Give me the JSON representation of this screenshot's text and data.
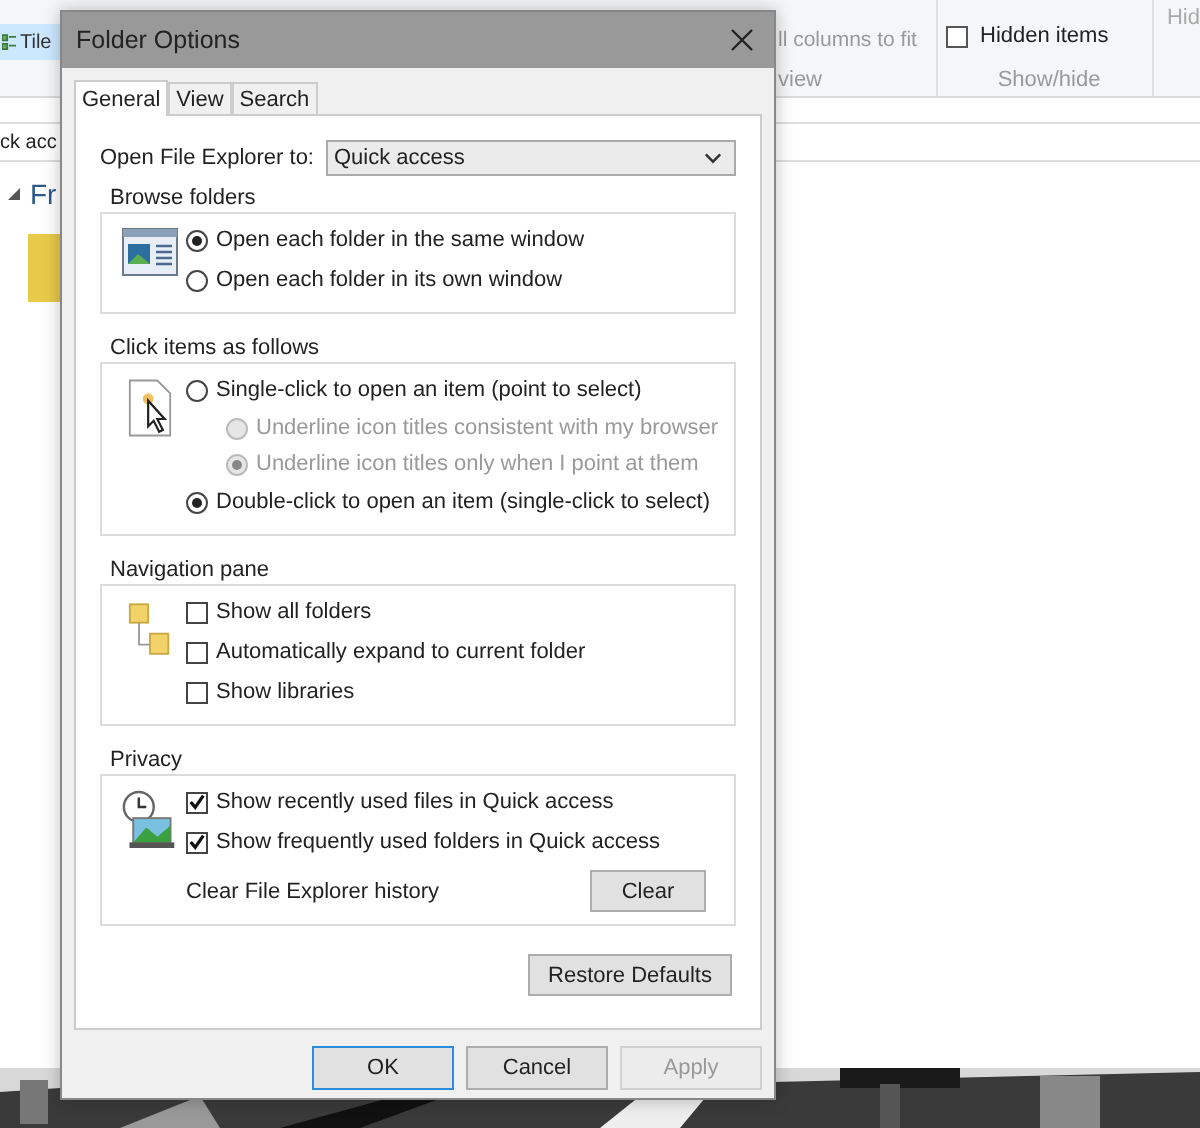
{
  "explorer": {
    "layout_items": [
      {
        "label": "Tile",
        "selected": true
      }
    ],
    "current_view": {
      "items": [
        "ll columns to fit"
      ],
      "group": "view"
    },
    "show_hide": {
      "items": [
        {
          "label": "Hidden items",
          "checked": false
        }
      ],
      "group": "Show/hide",
      "hide": "Hid"
    },
    "address": "ck acc",
    "nav_item": "Fr"
  },
  "dialog": {
    "title": "Folder Options",
    "tabs": [
      {
        "label": "General",
        "selected": true
      },
      {
        "label": "View",
        "selected": false
      },
      {
        "label": "Search",
        "selected": false
      }
    ],
    "open_to": {
      "label": "Open File Explorer to:",
      "value": "Quick access"
    },
    "groups": [
      {
        "kind": "radio",
        "title": "Browse folders",
        "options": [
          {
            "label": "Open each folder in the same window",
            "selected": true,
            "disabled": false
          },
          {
            "label": "Open each folder in its own window",
            "selected": false,
            "disabled": false
          }
        ]
      },
      {
        "kind": "radio",
        "title": "Click items as follows",
        "options": [
          {
            "label": "Single-click to open an item (point to select)",
            "selected": false,
            "disabled": false,
            "children": [
              {
                "label": "Underline icon titles consistent with my browser",
                "selected": false,
                "disabled": true
              },
              {
                "label": "Underline icon titles only when I point at them",
                "selected": true,
                "disabled": true
              }
            ]
          },
          {
            "label": "Double-click to open an item (single-click to select)",
            "selected": true,
            "disabled": false
          }
        ]
      },
      {
        "kind": "checkbox",
        "title": "Navigation pane",
        "options": [
          {
            "label": "Show all folders",
            "checked": false
          },
          {
            "label": "Automatically expand to current folder",
            "checked": false
          },
          {
            "label": "Show libraries",
            "checked": false
          }
        ]
      },
      {
        "kind": "checkbox",
        "title": "Privacy",
        "options": [
          {
            "label": "Show recently used files in Quick access",
            "checked": true
          },
          {
            "label": "Show frequently used folders in Quick access",
            "checked": true
          }
        ],
        "clear_label": "Clear File Explorer history",
        "clear_button": "Clear"
      }
    ],
    "restore_button": "Restore Defaults",
    "buttons": [
      {
        "label": "OK",
        "default": true,
        "disabled": false
      },
      {
        "label": "Cancel",
        "default": false,
        "disabled": false
      },
      {
        "label": "Apply",
        "default": false,
        "disabled": true
      }
    ]
  }
}
